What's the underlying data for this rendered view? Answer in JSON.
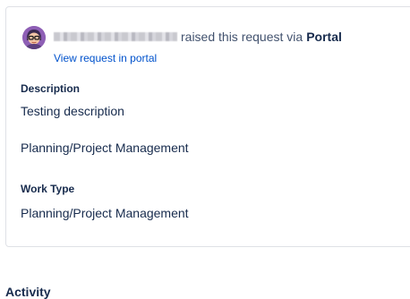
{
  "request": {
    "action_text": "raised this request via",
    "channel": "Portal",
    "view_link": "View request in portal"
  },
  "fields": {
    "description_label": "Description",
    "description_line1": "Testing description",
    "description_line2": "Planning/Project Management",
    "work_type_label": "Work Type",
    "work_type_value": "Planning/Project Management"
  },
  "activity": {
    "heading": "Activity"
  },
  "icons": {
    "avatar": "user-avatar-icon"
  }
}
